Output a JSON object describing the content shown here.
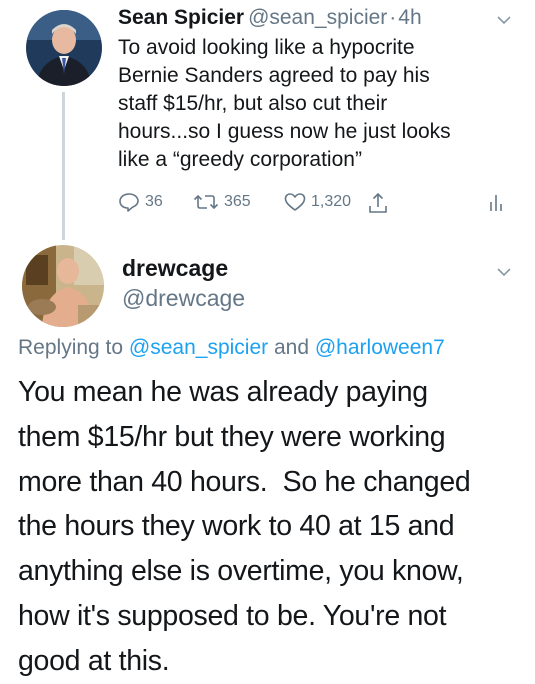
{
  "tweet": {
    "name": "Sean Spicier",
    "handle": "@sean_spicier",
    "separator": "·",
    "time": "4h",
    "lines": [
      "To avoid looking like a hypocrite",
      "Bernie Sanders agreed to pay his",
      "staff $15/hr, but also cut their",
      "hours...so I guess now he just looks",
      "like a “greedy corporation”"
    ],
    "reply_count": "36",
    "retweet_count": "365",
    "like_count": "1,320"
  },
  "reply": {
    "name": "drewcage",
    "handle": "@drewcage",
    "replying_prefix": "Replying to",
    "replying_user1": "@sean_spicier",
    "replying_and": "and",
    "replying_user2": "@harloween7",
    "lines": [
      "You mean he was already paying",
      "them $15/hr but they were working",
      "more than 40 hours.  So he changed",
      "the hours they work to 40 at 15 and",
      "anything else is overtime, you know,",
      "how it's supposed to be. You're not",
      "good at this."
    ]
  },
  "colors": {
    "text": "#14171a",
    "secondary": "#657786",
    "link": "#1da1f2",
    "thread_line": "#ccd6dd"
  },
  "icons": [
    "reply-icon",
    "retweet-icon",
    "like-icon",
    "share-icon",
    "analytics-icon",
    "chevron-down-icon"
  ]
}
